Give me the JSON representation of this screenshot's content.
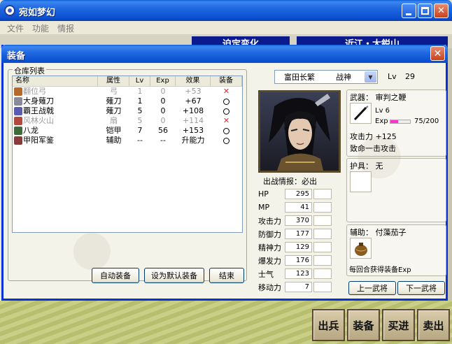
{
  "app": {
    "title": "宛如梦幻"
  },
  "menu": [
    "文件",
    "功能",
    "情报"
  ],
  "scene": {
    "banners": [
      "迫定变化",
      "近江・大鋭山"
    ],
    "commands": [
      "出兵",
      "装备",
      "买进",
      "卖出"
    ]
  },
  "dialog": {
    "title": "装备",
    "inventory": {
      "label": "仓库列表",
      "headers": [
        "名称",
        "属性",
        "Lv",
        "Exp",
        "效果",
        "装备"
      ],
      "rows": [
        {
          "icon": "bow-icon",
          "name": "翻位弓",
          "attr": "弓",
          "lv": "1",
          "exp": "0",
          "effect": "+53",
          "equip": "x",
          "usable": false
        },
        {
          "icon": "sword-icon",
          "name": "大身薙刀",
          "attr": "薙刀",
          "lv": "1",
          "exp": "0",
          "effect": "+67",
          "equip": "o",
          "usable": true
        },
        {
          "icon": "halberd-icon",
          "name": "覇王战戟",
          "attr": "薙刀",
          "lv": "5",
          "exp": "0",
          "effect": "+108",
          "equip": "o",
          "usable": true
        },
        {
          "icon": "fan-icon",
          "name": "风林火山",
          "attr": "扇",
          "lv": "5",
          "exp": "0",
          "effect": "+114",
          "equip": "x",
          "usable": false
        },
        {
          "icon": "armor-icon",
          "name": "八龙",
          "attr": "铠甲",
          "lv": "7",
          "exp": "56",
          "effect": "+153",
          "equip": "o",
          "usable": true
        },
        {
          "icon": "book-icon",
          "name": "甲阳军鉴",
          "attr": "辅助",
          "lv": "--",
          "exp": "--",
          "effect": "升能力",
          "equip": "o",
          "usable": true
        }
      ]
    },
    "buttons": {
      "auto": "自动装备",
      "default": "设为默认装备",
      "close": "结束",
      "prev": "上一武将",
      "next": "下一武将"
    },
    "general": {
      "name": "富田长繁",
      "class": "战神",
      "lv_label": "Lv",
      "lv": "29",
      "sortie": "出战情报：必出"
    },
    "stats": [
      {
        "label": "HP",
        "value": "295"
      },
      {
        "label": "MP",
        "value": "41"
      },
      {
        "label": "攻击力",
        "value": "370"
      },
      {
        "label": "防御力",
        "value": "177"
      },
      {
        "label": "精神力",
        "value": "129"
      },
      {
        "label": "爆发力",
        "value": "176"
      },
      {
        "label": "士气",
        "value": "123"
      },
      {
        "label": "移动力",
        "value": "7"
      }
    ],
    "weapon": {
      "label": "武器：",
      "name": "审判之鞭",
      "lv_text": "Lv  6",
      "exp_label": "Exp",
      "exp_text": "75/200",
      "exp_fraction": 0.375,
      "effect1": "攻击力 +125",
      "effect2": "致命一击攻击"
    },
    "armor": {
      "label": "护具：",
      "name": "无"
    },
    "accessory": {
      "label": "辅助：",
      "name": "付藻茄子",
      "effect": "每回合获得装备Exp"
    }
  }
}
